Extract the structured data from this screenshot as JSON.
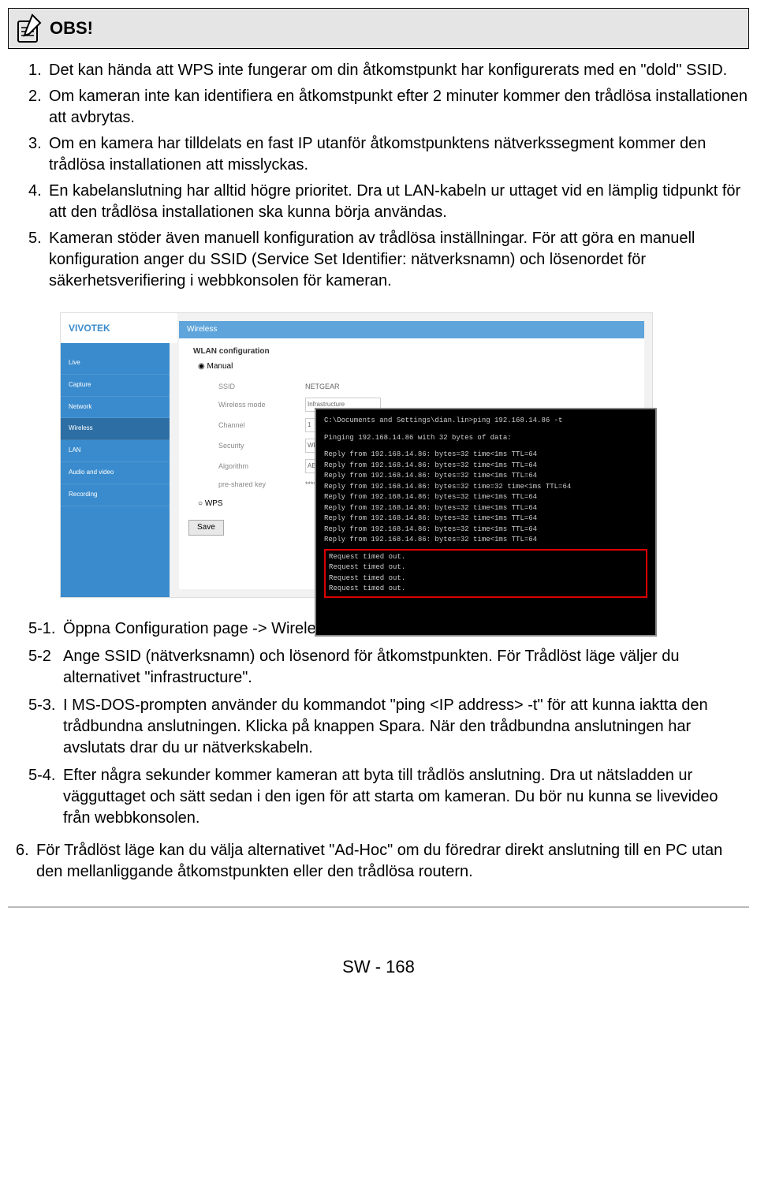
{
  "obs": {
    "title": "OBS!"
  },
  "list": {
    "i1": "Det kan hända att WPS inte fungerar om din åtkomstpunkt har konfigurerats med en \"dold\" SSID.",
    "i2": "Om kameran inte kan identifiera en åtkomstpunkt efter 2 minuter kommer den trådlösa installationen att avbrytas.",
    "i3": "Om en kamera har tilldelats en fast IP utanför åtkomstpunktens nätverkssegment kommer den trådlösa installationen att misslyckas.",
    "i4": "En kabelanslutning har alltid högre prioritet. Dra ut LAN-kabeln ur uttaget vid en lämplig tidpunkt för att den trådlösa installationen ska kunna börja användas.",
    "i5": "Kameran stöder även manuell konfiguration av trådlösa inställningar. För att göra en manuell konfiguration anger du SSID (Service Set Identifier: nätverksnamn) och lösenordet för säkerhetsverifiering i webbkonsolen för kameran."
  },
  "sub": {
    "s1": "Öppna Configuration page -> Wireless (konfigurationssida -> trådlös).",
    "s2": "Ange SSID (nätverksnamn) och lösenord för åtkomstpunkten. För Trådlöst läge väljer du alternativet \"infrastructure\".",
    "s3": "I MS-DOS-prompten använder du kommandot \"ping <IP address> -t\" för att kunna iaktta den trådbundna anslutningen. Klicka på knappen Spara. När den trådbundna anslutningen har avslutats drar du ur nätverkskabeln.",
    "s4": "Efter några sekunder kommer kameran att byta till trådlös anslutning. Dra ut nätsladden ur vägguttaget och sätt sedan i den igen för att starta om kameran. Du bör nu kunna se livevideo från webbkonsolen."
  },
  "outer": {
    "i6": "För Trådlöst läge kan du välja alternativet \"Ad-Hoc\" om du föredrar direkt anslutning till en PC utan den mellanliggande åtkomstpunkten eller den trådlösa routern."
  },
  "screenshot": {
    "logo": "VIVOTEK",
    "section_title": "Wireless",
    "section_sub": "WLAN configuration",
    "radio": "Manual",
    "nav": [
      "Live",
      "Capture",
      "Network",
      "Wireless",
      "LAN",
      "Audio and video",
      "Recording"
    ],
    "form": {
      "ssid_label": "SSID",
      "ssid_value": "NETGEAR",
      "mode_label": "Wireless mode",
      "mode_value": "Infrastructure",
      "channel_label": "Channel",
      "channel_value": "1",
      "security_label": "Security",
      "security_value": "WPA-PSK",
      "algo_label": "Algorithm",
      "algo_value": "AES",
      "key_label": "pre-shared key",
      "key_value": "********"
    },
    "wps_label": "WPS",
    "save": "Save"
  },
  "terminal": {
    "line1": "C:\\Documents and Settings\\dian.lin>ping 192.168.14.86 -t",
    "line2": "Pinging 192.168.14.86 with 32 bytes of data:",
    "r1": "Reply from 192.168.14.86: bytes=32 time<1ms TTL=64",
    "r2": "Reply from 192.168.14.86: bytes=32 time<1ms TTL=64",
    "r3": "Reply from 192.168.14.86: bytes=32 time<1ms TTL=64",
    "r4": "Reply from 192.168.14.86: bytes=32 time=32 time<1ms TTL=64",
    "r5": "Reply from 192.168.14.86: bytes=32 time<1ms TTL=64",
    "r6": "Reply from 192.168.14.86: bytes=32 time<1ms TTL=64",
    "r7": "Reply from 192.168.14.86: bytes=32 time<1ms TTL=64",
    "r8": "Reply from 192.168.14.86: bytes=32 time<1ms TTL=64",
    "r9": "Reply from 192.168.14.86: bytes=32 time<1ms TTL=64",
    "t1": "Request timed out.",
    "t2": "Request timed out.",
    "t3": "Request timed out.",
    "t4": "Request timed out."
  },
  "page": "SW - 168"
}
